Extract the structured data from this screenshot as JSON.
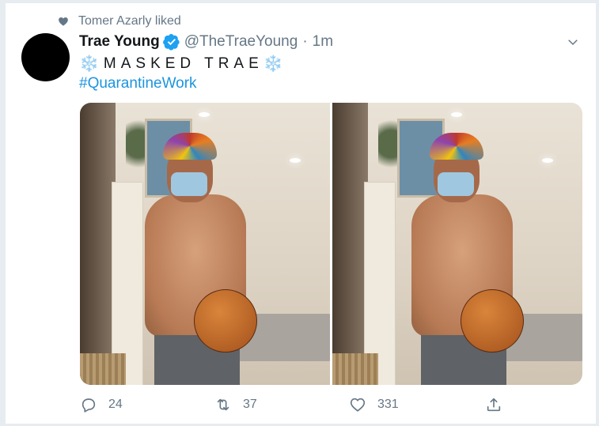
{
  "social_context": "Tomer Azarly liked",
  "tweet": {
    "name": "Trae Young",
    "handle": "@TheTraeYoung",
    "separator": "·",
    "time": "1m",
    "line1_flake_left": "❄️",
    "line1_text": "MASKED TRAE",
    "line1_flake_right": "❄️",
    "hashtag": "#QuarantineWork"
  },
  "actions": {
    "reply_count": "24",
    "retweet_count": "37",
    "like_count": "331"
  },
  "colors": {
    "link": "#1b95e0",
    "secondary_text": "#657786",
    "verified": "#1da1f2"
  }
}
